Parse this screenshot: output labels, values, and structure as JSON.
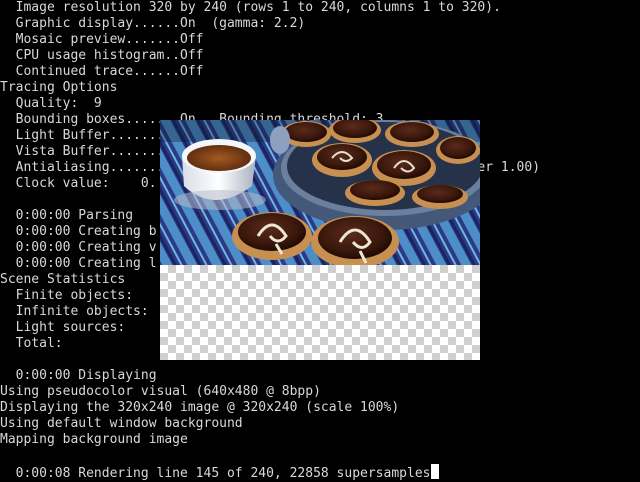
{
  "console": {
    "lines": [
      "  Image resolution 320 by 240 (rows 1 to 240, columns 1 to 320).",
      "  Graphic display......On  (gamma: 2.2)",
      "  Mosaic preview.......Off",
      "  CPU usage histogram..Off",
      "  Continued trace......Off",
      "Tracing Options",
      "  Quality:  9",
      "  Bounding boxes.......On   Bounding threshold: 3",
      "  Light Buffer.........",
      "  Vista Buffer.........",
      "  Antialiasing.........                               3, Jitter 1.00)",
      "  Clock value:    0.",
      "",
      "  0:00:00 Parsing",
      "  0:00:00 Creating b",
      "  0:00:00 Creating v",
      "  0:00:00 Creating l",
      "Scene Statistics",
      "  Finite objects:",
      "  Infinite objects:",
      "  Light sources:",
      "  Total:",
      "",
      "  0:00:00 Displaying",
      "Using pseudocolor visual (640x480 @ 8bpp)",
      "Displaying the 320x240 image @ 320x240 (scale 100%)",
      "Using default window background",
      "Mapping background image",
      "",
      "  0:00:08 Rendering line 145 of 240, 22858 supersamples"
    ]
  },
  "preview": {
    "rendered_rows": 145,
    "total_rows": 240,
    "scene": "render of a coffee cup beside a tin of decorated cookies on a blue striped cloth"
  }
}
